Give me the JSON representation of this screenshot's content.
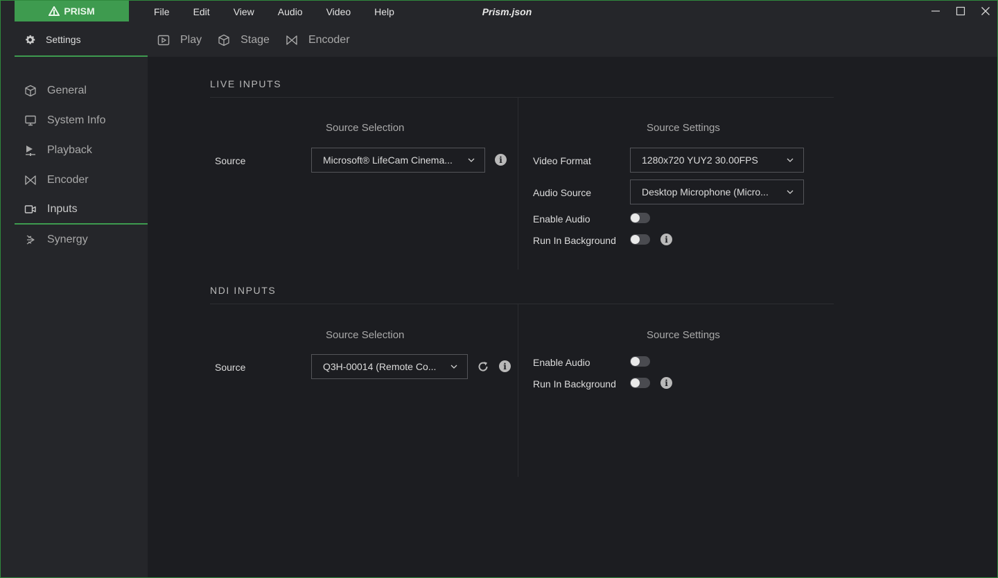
{
  "app": {
    "brand": "PRISM",
    "window_title": "Prism.json"
  },
  "menu": [
    "File",
    "Edit",
    "View",
    "Audio",
    "Video",
    "Help"
  ],
  "toolbar": {
    "settings_label": "Settings",
    "tabs": [
      {
        "label": "Play",
        "icon": "play-frame-icon"
      },
      {
        "label": "Stage",
        "icon": "cube-icon"
      },
      {
        "label": "Encoder",
        "icon": "encoder-icon"
      }
    ]
  },
  "sidebar": {
    "items": [
      {
        "label": "General",
        "icon": "cube-icon"
      },
      {
        "label": "System Info",
        "icon": "monitor-icon"
      },
      {
        "label": "Playback",
        "icon": "playback-icon"
      },
      {
        "label": "Encoder",
        "icon": "encoder-icon"
      },
      {
        "label": "Inputs",
        "icon": "camera-icon",
        "active": true
      },
      {
        "label": "Synergy",
        "icon": "synergy-icon"
      }
    ]
  },
  "live_inputs": {
    "title": "LIVE INPUTS",
    "source_selection_header": "Source Selection",
    "source_settings_header": "Source Settings",
    "source_label": "Source",
    "source_value": "Microsoft® LifeCam Cinema...",
    "video_format_label": "Video Format",
    "video_format_value": "1280x720 YUY2 30.00FPS",
    "audio_source_label": "Audio Source",
    "audio_source_value": "Desktop Microphone (Micro...",
    "enable_audio_label": "Enable Audio",
    "enable_audio": false,
    "run_in_background_label": "Run In Background",
    "run_in_background": false
  },
  "ndi_inputs": {
    "title": "NDI INPUTS",
    "source_selection_header": "Source Selection",
    "source_settings_header": "Source Settings",
    "source_label": "Source",
    "source_value": "Q3H-00014 (Remote Co...",
    "enable_audio_label": "Enable Audio",
    "enable_audio": false,
    "run_in_background_label": "Run In Background",
    "run_in_background": false
  },
  "colors": {
    "accent": "#3e9b4f",
    "background": "#1c1d21",
    "panel": "#25262a"
  }
}
